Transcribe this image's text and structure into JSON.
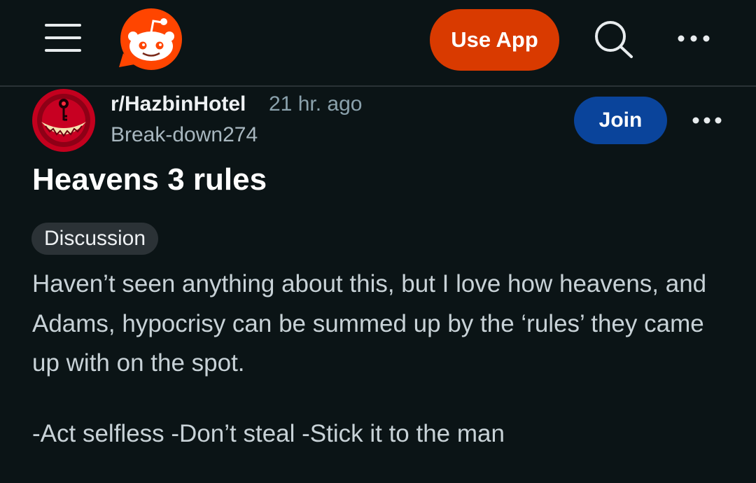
{
  "header": {
    "menu_icon": "hamburger-menu-icon",
    "logo_icon": "reddit-snoo-logo-icon",
    "use_app_label": "Use App",
    "search_icon": "search-icon",
    "more_icon": "more-dots-icon"
  },
  "post": {
    "subreddit": "r/HazbinHotel",
    "time_ago": "21 hr. ago",
    "author": "Break-down274",
    "join_label": "Join",
    "more_icon": "more-dots-icon",
    "title": "Heavens 3 rules",
    "flair": "Discussion",
    "body": [
      "Haven’t seen anything about this, but I love how heavens, and Adams, hypocrisy can be summed up by the ‘rules’ they came up with on the spot.",
      "-Act selfless -Don’t steal -Stick it to the man"
    ]
  },
  "colors": {
    "background": "#0b1416",
    "use_app_button": "#d93a00",
    "join_button": "#0a449b",
    "reddit_orange": "#ff4500"
  }
}
